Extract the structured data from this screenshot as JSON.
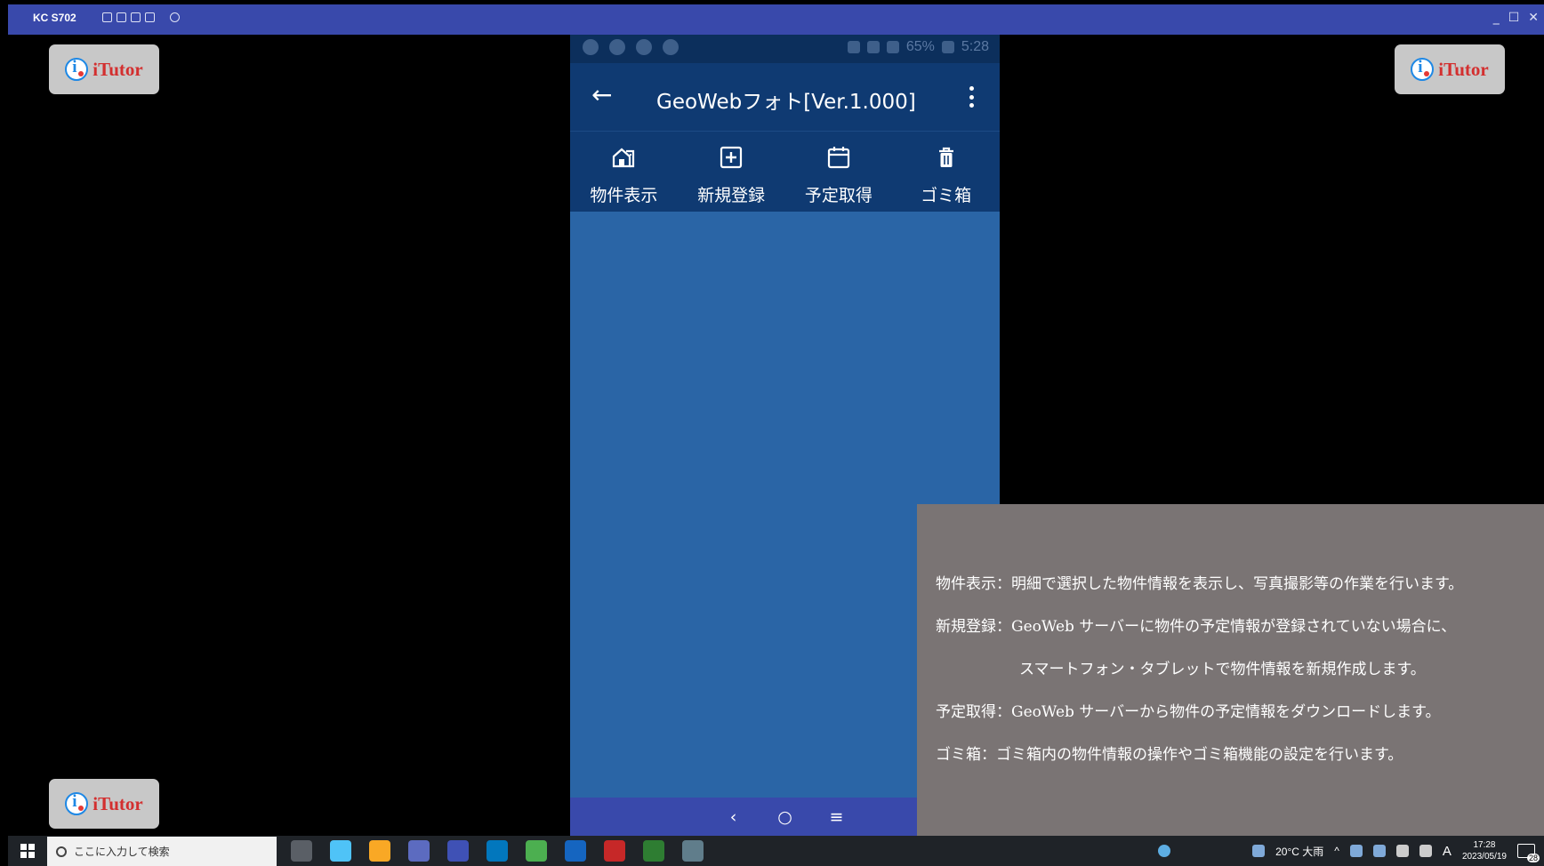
{
  "window": {
    "title": "KC S702",
    "controls": [
      "_",
      "☐",
      "✕"
    ]
  },
  "watermark": {
    "text": "iTutor"
  },
  "phone": {
    "status": {
      "battery": "65%",
      "time": "5:28"
    },
    "app_bar": {
      "title": "GeoWebフォト[Ver.1.000]"
    },
    "toolbar": [
      {
        "label": "物件表示",
        "icon": "house-icon"
      },
      {
        "label": "新規登録",
        "icon": "add-box-icon"
      },
      {
        "label": "予定取得",
        "icon": "calendar-icon"
      },
      {
        "label": "ゴミ箱",
        "icon": "trash-icon"
      }
    ],
    "nav": {
      "back": "‹",
      "home": "○",
      "menu": "≡"
    }
  },
  "caption": {
    "lines": [
      "物件表示：明細で選択した物件情報を表示し、写真撮影等の作業を行います。",
      "新規登録：GeoWeb サーバーに物件の予定情報が登録されていない場合に、",
      "スマートフォン・タブレットで物件情報を新規作成します。",
      "予定取得：GeoWeb サーバーから物件の予定情報をダウンロードします。",
      "ゴミ箱：ゴミ箱内の物件情報の操作やゴミ箱機能の設定を行います。"
    ]
  },
  "taskbar": {
    "search_placeholder": "ここに入力して検索",
    "weather": "20°C 大雨",
    "ime": "A",
    "time": "17:28",
    "date": "2023/05/19",
    "notifications": "28",
    "app_colors": [
      "#4fc3f7",
      "#f9a825",
      "#5c6bc0",
      "#3f51b5",
      "#0277bd",
      "#4caf50",
      "#1565c0",
      "#c62828",
      "#2e7d32",
      "#607d8b"
    ]
  }
}
